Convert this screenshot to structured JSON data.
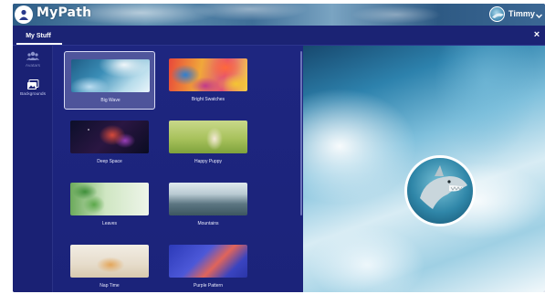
{
  "header": {
    "app_name": "MyPath",
    "user_name": "Timmy",
    "user_menu_icon": "chevron-down-icon",
    "logo_icon": "person-icon"
  },
  "tabs": {
    "active_tab_label": "My Stuff",
    "close_label": "×"
  },
  "sidebar": {
    "items": [
      {
        "label": "Avatars",
        "icon": "people-icon"
      },
      {
        "label": "Backgrounds",
        "icon": "image-icon"
      }
    ]
  },
  "backgrounds": {
    "items": [
      {
        "label": "Big Wave",
        "selected": true
      },
      {
        "label": "Bright Swatches",
        "selected": false
      },
      {
        "label": "Deep Space",
        "selected": false
      },
      {
        "label": "Happy Puppy",
        "selected": false
      },
      {
        "label": "Leaves",
        "selected": false
      },
      {
        "label": "Mountains",
        "selected": false
      },
      {
        "label": "Nap Time",
        "selected": false
      },
      {
        "label": "Purple Pattern",
        "selected": false
      }
    ]
  },
  "colors": {
    "panel_bg": "#1b2374",
    "accent_text": "#ffffff"
  }
}
